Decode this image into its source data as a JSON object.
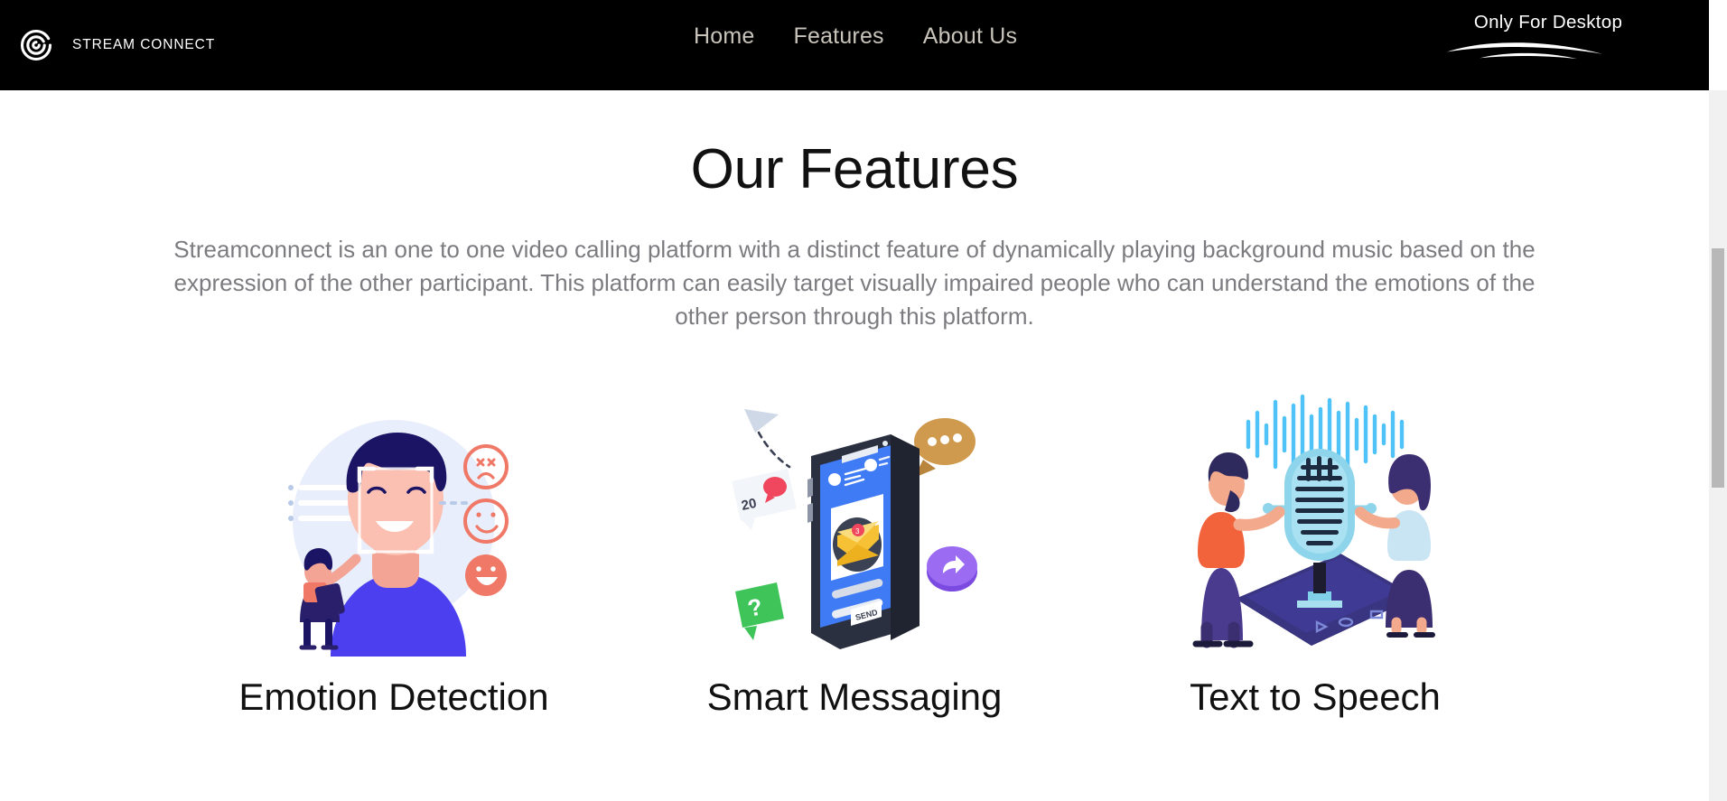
{
  "brand": {
    "name": "STREAM CONNECT",
    "logo_icon": "spiral-logo-icon"
  },
  "nav": {
    "links": [
      {
        "label": "Home"
      },
      {
        "label": "Features"
      },
      {
        "label": "About Us"
      }
    ]
  },
  "notice": {
    "text": "Only For Desktop",
    "underline_icon": "brush-stroke-underline-icon"
  },
  "main": {
    "title": "Our Features",
    "description": "Streamconnect is an one to one video calling platform with a distinct feature of dynamically playing background music based on the expression of the other participant. This platform can easily target visually impaired people who can understand the emotions of the other person through this platform.",
    "cards": [
      {
        "title": "Emotion Detection",
        "art_icon": "emotion-detection-illustration"
      },
      {
        "title": "Smart Messaging",
        "art_icon": "smart-messaging-illustration",
        "art_labels": {
          "badge_count": "20",
          "send_button": "SEND",
          "question_mark": "?"
        }
      },
      {
        "title": "Text to Speech",
        "art_icon": "text-to-speech-illustration"
      }
    ]
  },
  "colors": {
    "navbar_bg": "#000000",
    "nav_link": "#c9c4bb",
    "page_bg": "#ffffff",
    "heading": "#111111",
    "body_text": "#7c7c80",
    "accent_blue": "#4b4bdc",
    "accent_coral": "#ef8a7d",
    "scrollbar_thumb": "#b8b8b8"
  }
}
